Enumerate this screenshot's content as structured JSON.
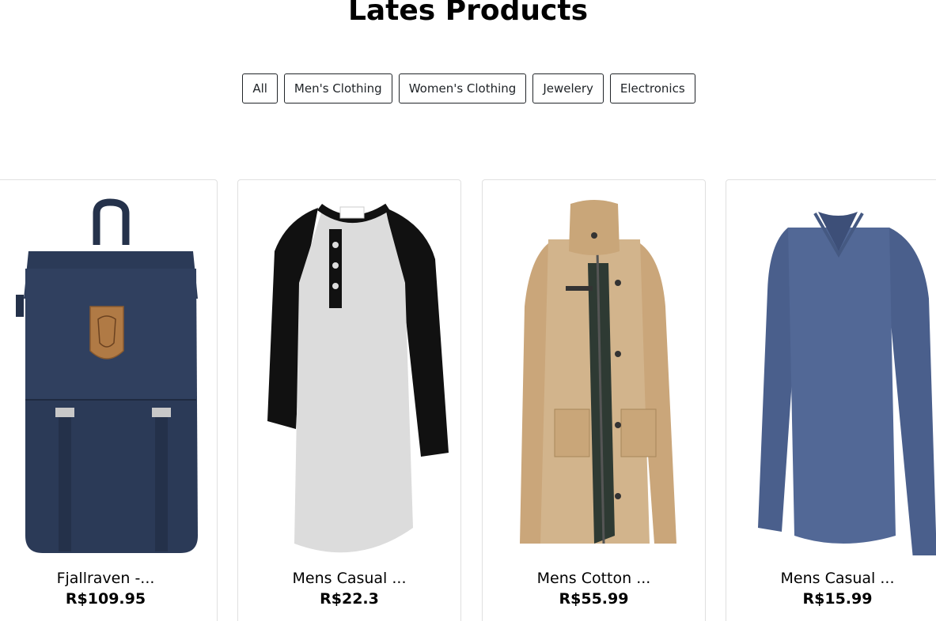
{
  "heading": "Lates Products",
  "filters": [
    {
      "label": "All"
    },
    {
      "label": "Men's Clothing"
    },
    {
      "label": "Women's Clothing"
    },
    {
      "label": "Jewelery"
    },
    {
      "label": "Electronics"
    }
  ],
  "products": [
    {
      "title": "Fjallraven -...",
      "price": "R$109.95",
      "image": "backpack-image",
      "color": "#2b3a57"
    },
    {
      "title": "Mens Casual ...",
      "price": "R$22.3",
      "image": "raglan-tshirt-image",
      "color": "#d9d9d9"
    },
    {
      "title": "Mens Cotton ...",
      "price": "R$55.99",
      "image": "cotton-jacket-image",
      "color": "#d2b48c"
    },
    {
      "title": "Mens Casual ...",
      "price": "R$15.99",
      "image": "slim-fit-shirt-image",
      "color": "#4f6491"
    }
  ]
}
